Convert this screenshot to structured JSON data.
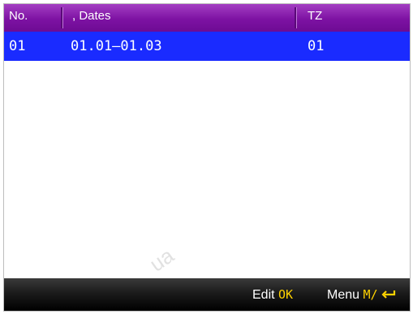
{
  "header": {
    "col_no": "No.",
    "col_dates": ", Dates",
    "col_tz": "TZ"
  },
  "rows": [
    {
      "no": "01",
      "dates": "01.01—01.03",
      "tz": "01",
      "selected": true
    }
  ],
  "footer": {
    "edit_label": "Edit",
    "edit_key": "OK",
    "menu_label": "Menu",
    "menu_key": "M/",
    "menu_key_icon": "enter-arrow-icon"
  },
  "watermark": "ua",
  "colors": {
    "header_bg": "#7d12a3",
    "selected_row_bg": "#1a2bff",
    "footer_bg": "#111111",
    "key_hint": "#ffd200"
  }
}
